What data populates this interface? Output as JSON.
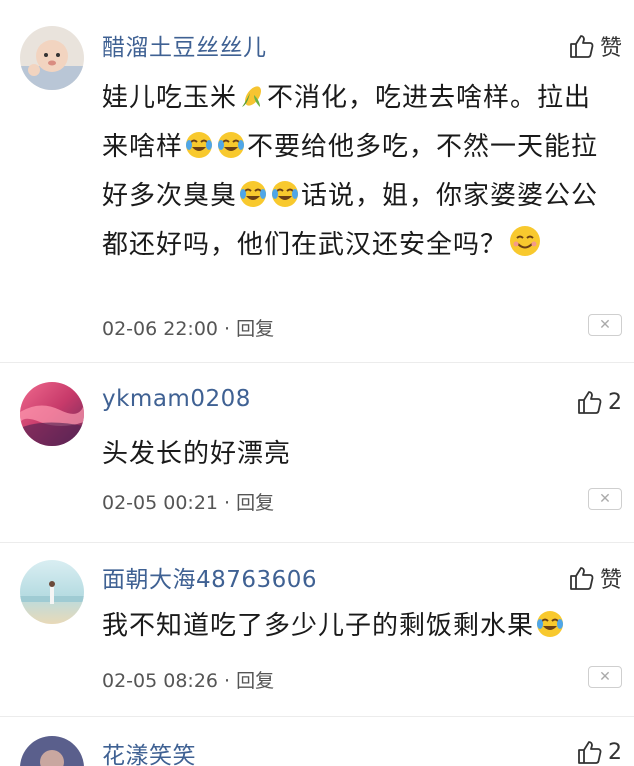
{
  "comments": [
    {
      "username": "醋溜土豆丝丝儿",
      "likes": "赞",
      "text_parts": [
        "娃儿吃玉米",
        "不消化，吃进去啥样。拉出来啥样",
        "不要给他多吃，不然一天能拉好多次臭臭",
        "话说，姐，你家婆婆公公都还好吗，他们在武汉还安全吗？"
      ],
      "timestamp": "02-06 22:00",
      "reply_label": "回复"
    },
    {
      "username": "ykmam0208",
      "likes": "2",
      "text": "头发长的好漂亮",
      "timestamp": "02-05 00:21",
      "reply_label": "回复"
    },
    {
      "username": "面朝大海48763606",
      "likes": "赞",
      "text": "我不知道吃了多少儿子的剩饭剩水果",
      "timestamp": "02-05 08:26",
      "reply_label": "回复"
    },
    {
      "username": "花漾笑笑",
      "likes": "2"
    }
  ],
  "meta_separator": "·",
  "icons": {
    "like": "thumbs-up-icon",
    "close": "close-icon",
    "corn": "corn-emoji",
    "crying": "crying-laughing-emoji",
    "smile": "smiling-emoji"
  },
  "colors": {
    "username": "#3f6193",
    "text": "#1a1a1a",
    "meta": "#555555"
  }
}
